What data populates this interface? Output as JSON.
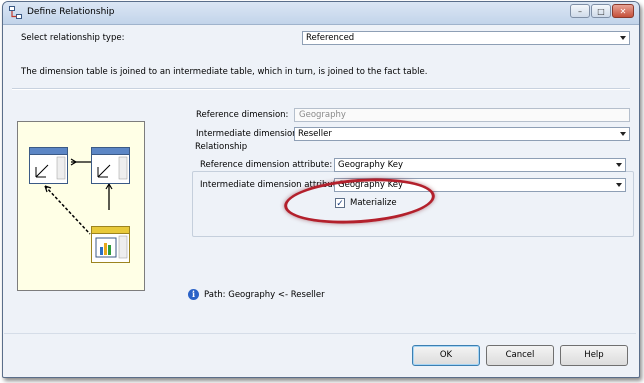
{
  "window": {
    "title": "Define Relationship",
    "controls": [
      "–",
      "□",
      "✕"
    ]
  },
  "relationship_type": {
    "label": "Select relationship type:",
    "value": "Referenced"
  },
  "description": "The dimension table is joined to an intermediate table, which in turn, is joined to the fact table.",
  "reference_dimension": {
    "label": "Reference dimension:",
    "value": "Geography"
  },
  "intermediate_dimension": {
    "label": "Intermediate dimension:",
    "value": "Reseller"
  },
  "relationship_group": {
    "title": "Relationship",
    "reference_attribute": {
      "label": "Reference dimension attribute:",
      "value": "Geography Key"
    },
    "intermediate_attribute": {
      "label": "Intermediate dimension attribute:",
      "value": "Geography Key"
    },
    "materialize": {
      "label": "Materialize",
      "checked": true,
      "check_glyph": "✓"
    }
  },
  "path_info": "Path: Geography <- Reseller",
  "buttons": {
    "ok": "OK",
    "cancel": "Cancel",
    "help": "Help"
  },
  "colors": {
    "dim_header": "#5c86c5",
    "fact_header": "#e8c93a",
    "highlight": "#b3202c"
  }
}
